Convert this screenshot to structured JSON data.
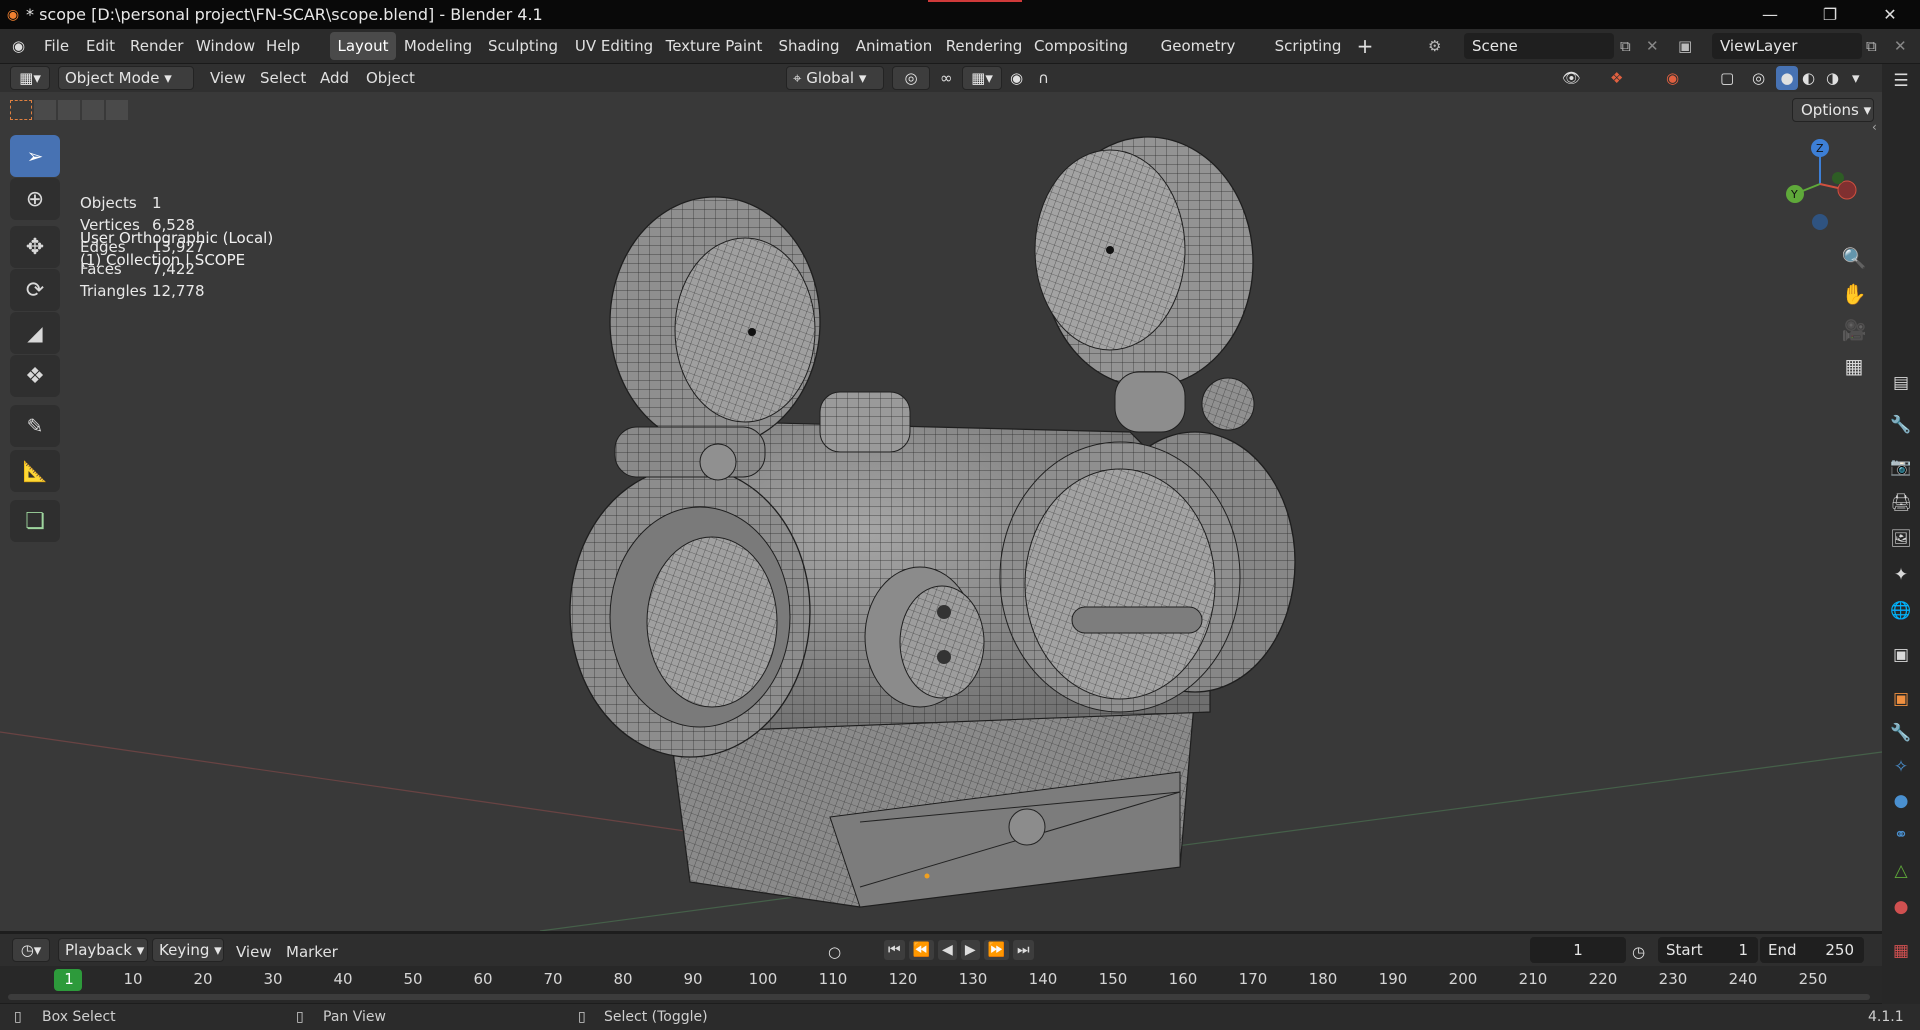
{
  "window": {
    "title": "* scope [D:\\personal project\\FN-SCAR\\scope.blend] - Blender 4.1"
  },
  "menu": [
    "File",
    "Edit",
    "Render",
    "Window",
    "Help"
  ],
  "workspaces": [
    "Layout",
    "Modeling",
    "Sculpting",
    "UV Editing",
    "Texture Paint",
    "Shading",
    "Animation",
    "Rendering",
    "Compositing",
    "Geometry Nodes",
    "Scripting"
  ],
  "active_workspace": "Layout",
  "scene": "Scene",
  "view_layer": "ViewLayer",
  "header": {
    "mode": "Object Mode",
    "menus": [
      "View",
      "Select",
      "Add",
      "Object"
    ],
    "orientation": "Global",
    "options": "Options"
  },
  "viewport": {
    "view_name": "User Orthographic (Local)",
    "collection": "(1) Collection | SCOPE",
    "stats": [
      {
        "label": "Objects",
        "value": "1"
      },
      {
        "label": "Vertices",
        "value": "6,528"
      },
      {
        "label": "Edges",
        "value": "13,927"
      },
      {
        "label": "Faces",
        "value": "7,422"
      },
      {
        "label": "Triangles",
        "value": "12,778"
      }
    ],
    "gizmo": {
      "z": "Z",
      "y": "Y"
    }
  },
  "timeline": {
    "menus": [
      "Playback",
      "Keying",
      "View",
      "Marker"
    ],
    "current_frame": "1",
    "start_label": "Start",
    "start": "1",
    "end_label": "End",
    "end": "250",
    "frame_ticks": [
      "1",
      "10",
      "20",
      "30",
      "40",
      "50",
      "60",
      "70",
      "80",
      "90",
      "100",
      "110",
      "120",
      "130",
      "140",
      "150",
      "160",
      "170",
      "180",
      "190",
      "200",
      "210",
      "220",
      "230",
      "240",
      "250"
    ]
  },
  "status": {
    "left": "Box Select",
    "middle": "Pan View",
    "right": "Select (Toggle)",
    "version": "4.1.1"
  },
  "colors": {
    "accent": "#4772b3",
    "x_axis": "#d0503f",
    "y_axis": "#5fa93a",
    "z_axis": "#3d7fd6",
    "keyframe": "#2d9a3b"
  }
}
